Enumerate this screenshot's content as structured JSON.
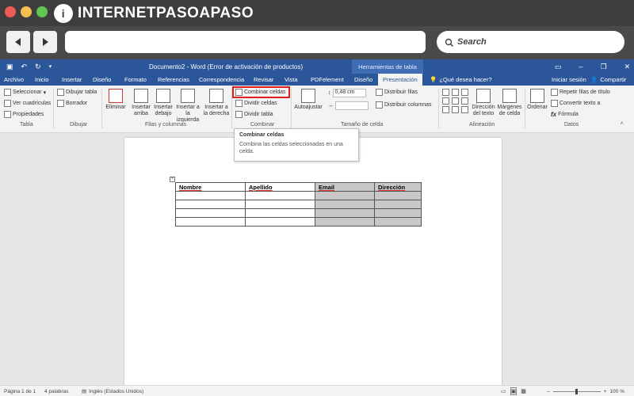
{
  "browser": {
    "logo_text": "INTERNETPASOAPASO",
    "logo_letter": "i",
    "search_label": "Search",
    "traffic_colors": [
      "#ed5b52",
      "#f4bf4f",
      "#61c554"
    ]
  },
  "word": {
    "title": "Documento2 - Word (Error de activación de productos)",
    "context_tab": "Herramientas de tabla",
    "menu": [
      "Archivo",
      "Inicio",
      "Insertar",
      "Diseño",
      "Formato",
      "Referencias",
      "Correspondencia",
      "Revisar",
      "Vista",
      "PDFelement",
      "Diseño",
      "Presentación"
    ],
    "active_menu": "Presentación",
    "tell_me": "¿Qué desea hacer?",
    "sign_in": "Iniciar sesión",
    "share": "Compartir"
  },
  "ribbon": {
    "tabla": {
      "items": [
        "Seleccionar",
        "Ver cuadrículas",
        "Propiedades"
      ],
      "label": "Tabla"
    },
    "dibujar": {
      "items": [
        "Dibujar tabla",
        "Borrador"
      ],
      "label": "Dibujar"
    },
    "filas_columnas": {
      "eliminar": "Eliminar",
      "insertar_arriba": "Insertar arriba",
      "insertar_debajo": "Insertar debajo",
      "insertar_izquierda": "Insertar a la izquierda",
      "insertar_derecha": "Insertar a la derecha",
      "label": "Filas y columnas"
    },
    "combinar": {
      "items": [
        "Combinar celdas",
        "Dividir celdas",
        "Dividir tabla"
      ],
      "label": "Combinar"
    },
    "tamano": {
      "autoajustar": "Autoajustar",
      "height": "0,48 cm",
      "distribuir_filas": "Distribuir filas",
      "distribuir_columnas": "Distribuir columnas",
      "label": "Tamaño de celda"
    },
    "alineacion": {
      "direccion": "Dirección del texto",
      "margenes": "Márgenes de celda",
      "label": "Alineación"
    },
    "datos": {
      "ordenar": "Ordenar",
      "repetir": "Repetir filas de título",
      "convertir": "Convertir texto a",
      "formula": "Fórmula",
      "label": "Datos"
    }
  },
  "tooltip": {
    "title": "Combinar celdas",
    "description": "Combina las celdas seleccionadas en una celda."
  },
  "table": {
    "headers": [
      "Nombre",
      "Apellido",
      "Email",
      "Dirección"
    ],
    "rows": 4
  },
  "status": {
    "page": "Página 1 de 1",
    "words": "4 palabras",
    "language": "Inglés (Estados Unidos)",
    "zoom": "100 %"
  },
  "colors": {
    "word_blue": "#2b579a",
    "highlight_red": "#e02020",
    "selected_cell": "#c8c8c8"
  }
}
